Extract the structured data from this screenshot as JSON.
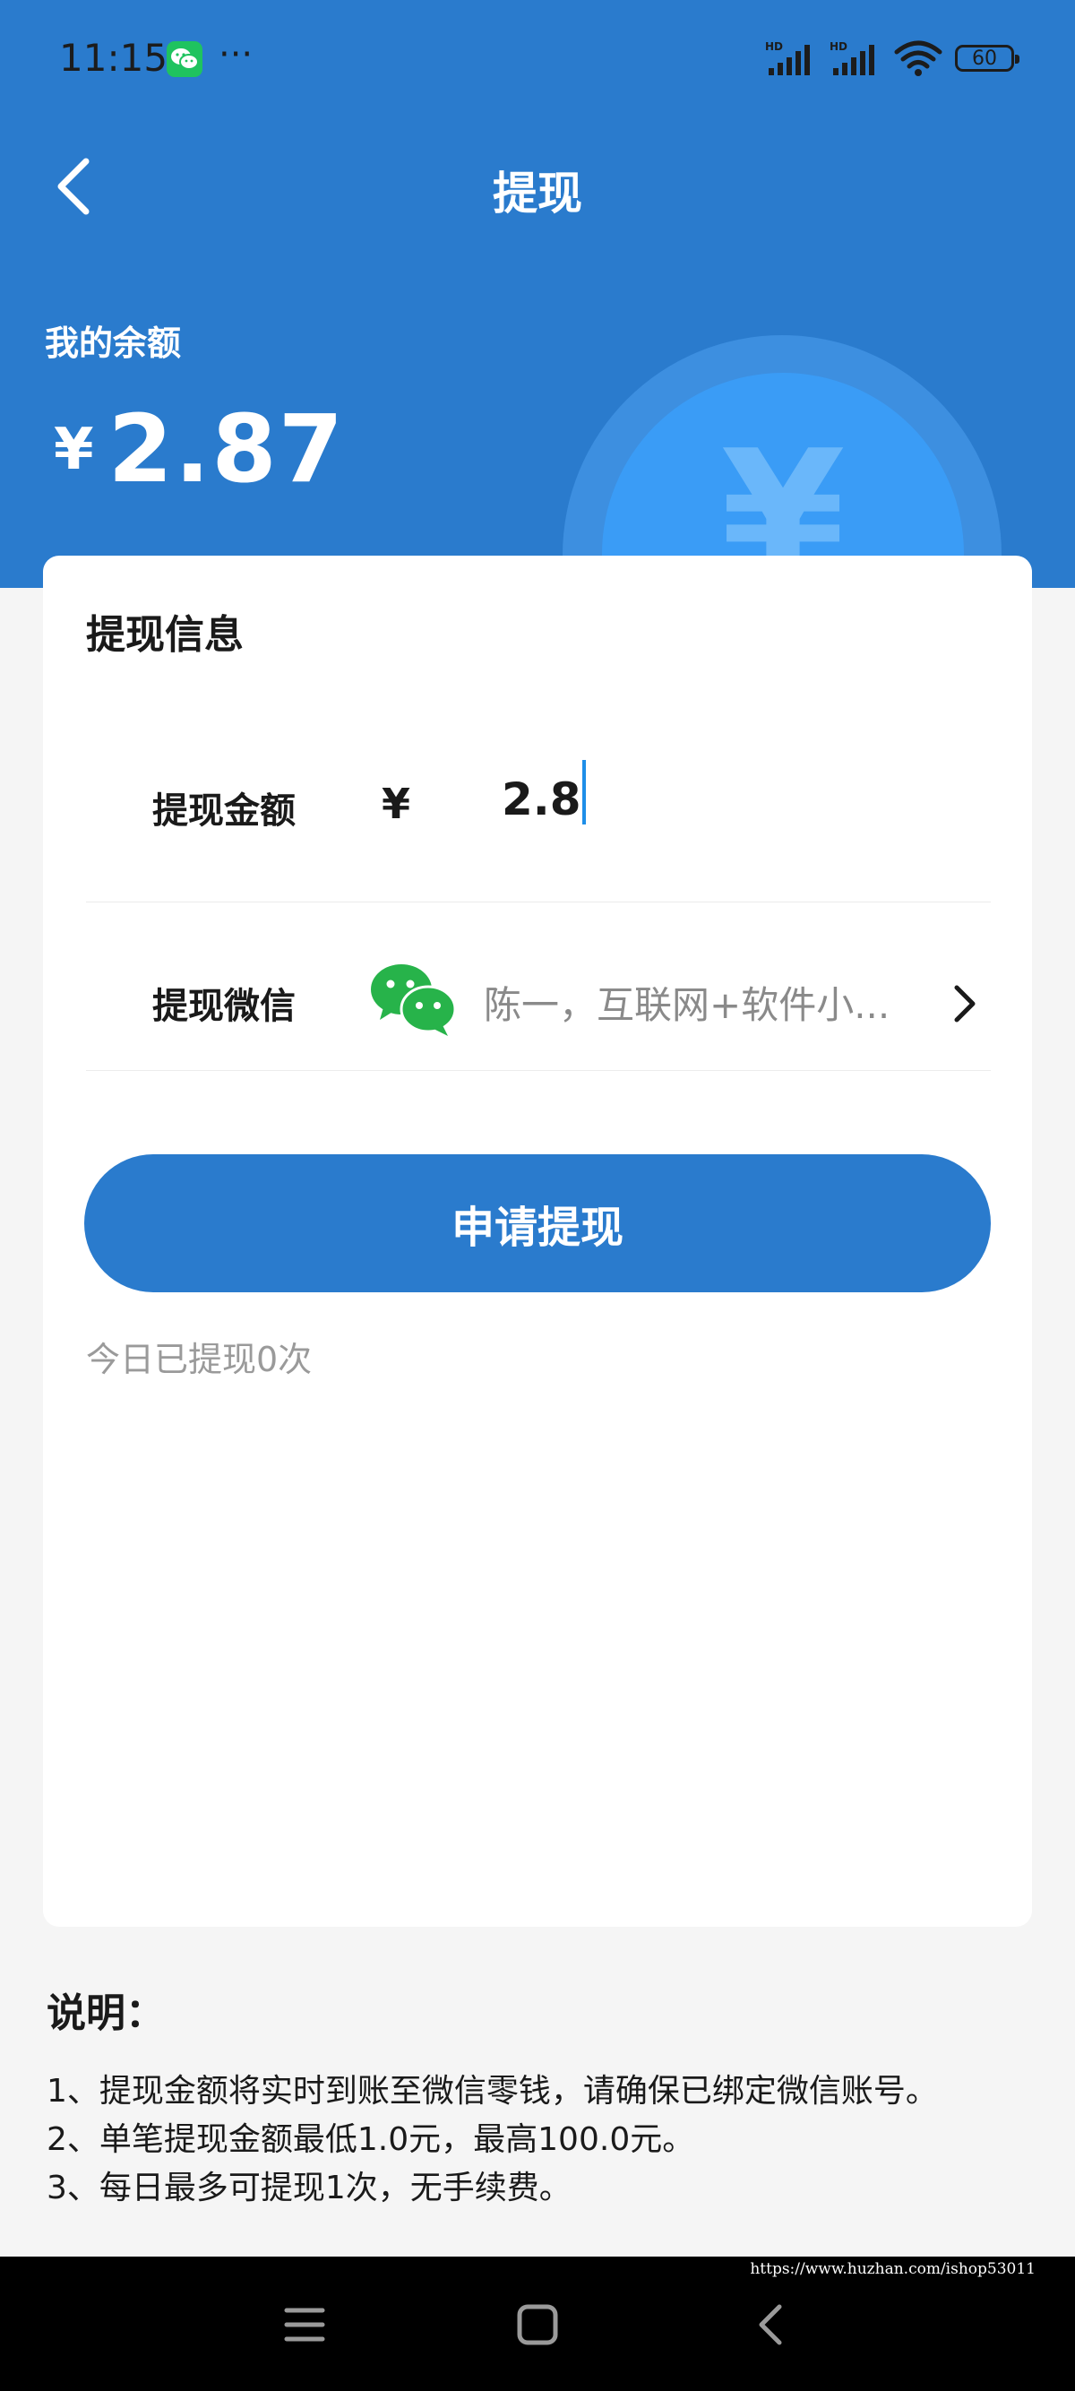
{
  "status_bar": {
    "time": "11:15",
    "dots": "···",
    "battery": "60",
    "icons": [
      "wechat-icon",
      "signal-hd-icon",
      "signal-hd-icon",
      "wifi-icon",
      "battery-icon"
    ]
  },
  "nav": {
    "title": "提现",
    "back_icon": "chevron-left-icon"
  },
  "balance": {
    "label": "我的余额",
    "currency": "¥",
    "amount": "2.87"
  },
  "form": {
    "title": "提现信息",
    "amount_label": "提现金额",
    "currency": "¥",
    "amount_value": "2.8",
    "wechat_label": "提现微信",
    "wechat_account": "陈一，互联网+软件小...",
    "submit_label": "申请提现",
    "today_count": "今日已提现0次"
  },
  "notes": {
    "title": "说明：",
    "lines": [
      "1、提现金额将实时到账至微信零钱，请确保已绑定微信账号。",
      "2、单笔提现金额最低1.0元，最高100.0元。",
      "3、每日最多可提现1次，无手续费。"
    ]
  },
  "watermark": "https://www.huzhan.com/ishop53011",
  "colors": {
    "primary": "#2a7bcd",
    "coin": "#3a9cf6",
    "wechat_green": "#1fc35f",
    "caret": "#1e8ee8",
    "muted_text": "#8a8a8a"
  }
}
